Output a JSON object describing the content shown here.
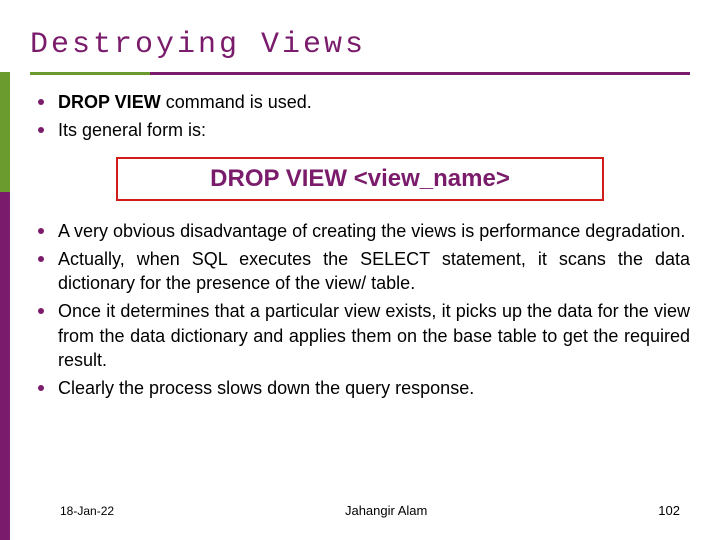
{
  "title": "Destroying Views",
  "bullets_top": [
    {
      "bold_lead": "DROP VIEW",
      "rest": "  command is used."
    },
    {
      "bold_lead": "",
      "rest": "Its general form is:"
    }
  ],
  "syntax": "DROP VIEW <view_name>",
  "bullets_bottom": [
    "A very obvious disadvantage of creating the views is performance degradation.",
    "Actually, when SQL executes the SELECT statement, it scans the data dictionary for the presence of the view/ table.",
    "Once it determines that a particular view exists, it picks up the data for the view from the data dictionary and applies them on the base table to get the required result.",
    "Clearly the process slows down the query response."
  ],
  "footer": {
    "date": "18-Jan-22",
    "author": "Jahangir Alam",
    "page": "102"
  }
}
